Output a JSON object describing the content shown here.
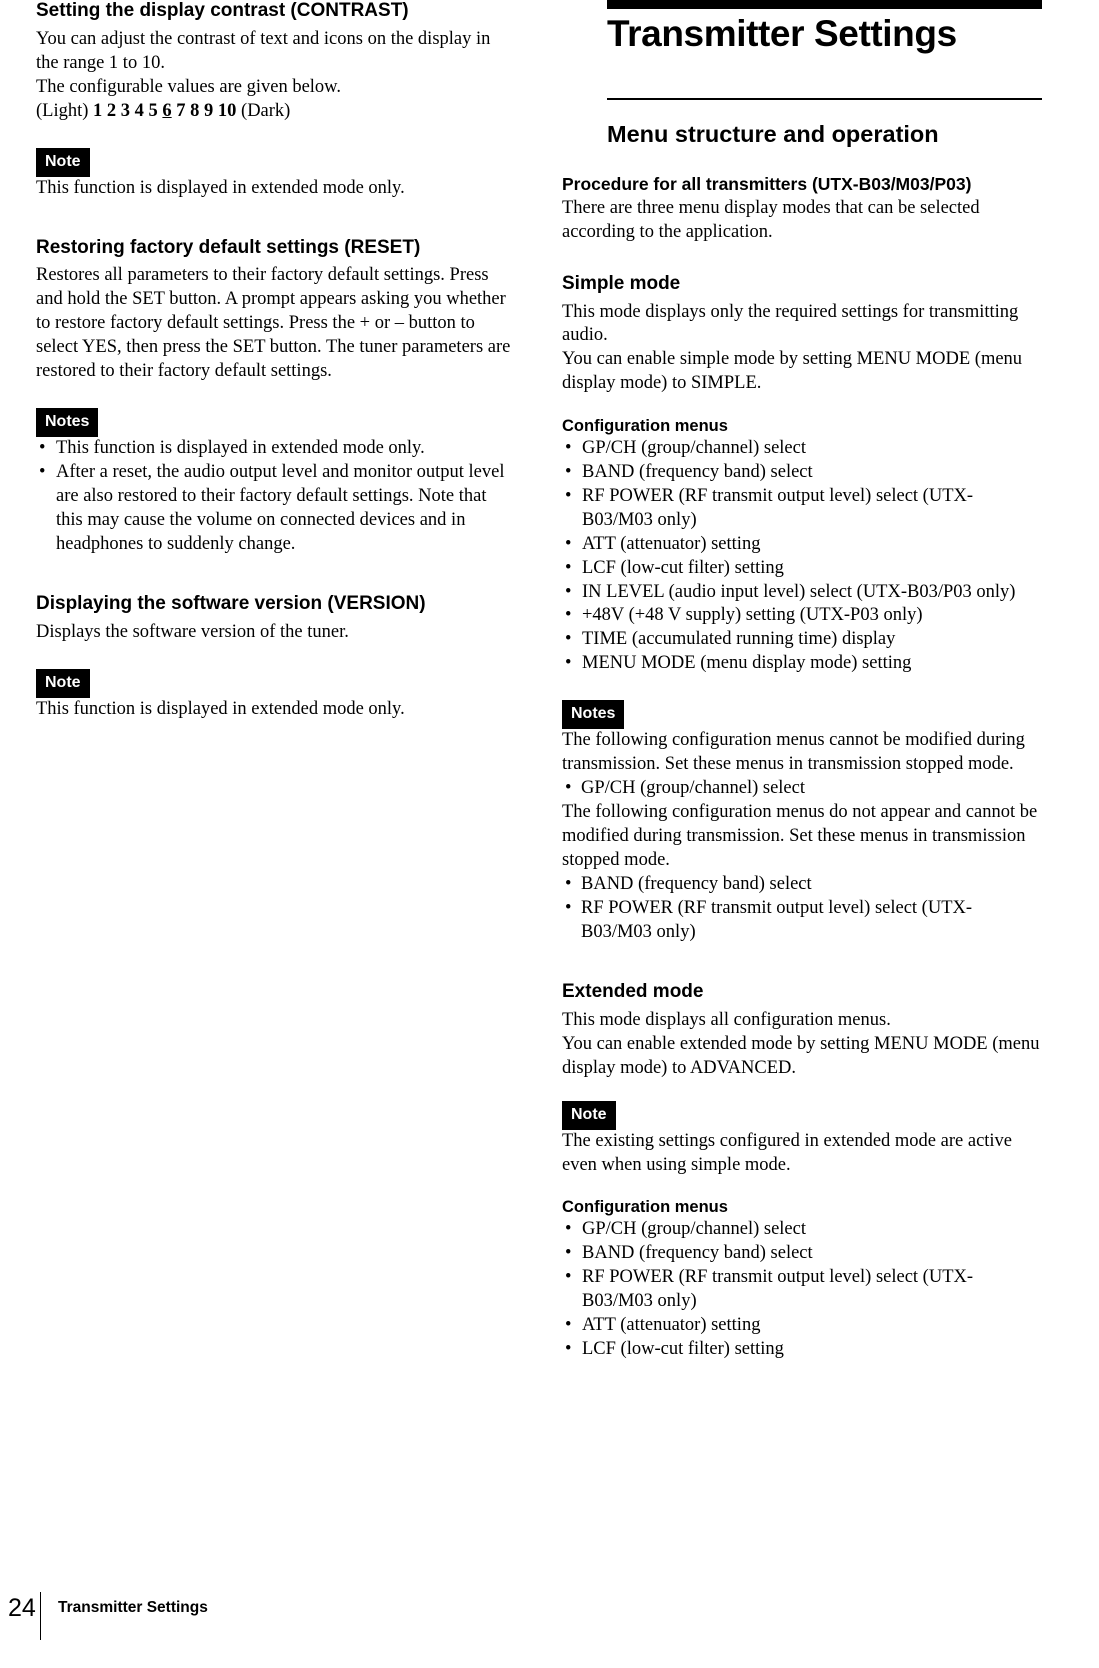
{
  "left_column": {
    "contrast_section": {
      "heading": "Setting the display contrast (CONTRAST)",
      "paragraph": "You can adjust the contrast of text and icons on the display in the range 1 to 10.\nThe configurable values are given below.",
      "scale_prefix": "(Light) ",
      "scale_values_before": "1 2 3 4 5 ",
      "scale_default": "6",
      "scale_values_after": " 7 8 9 10",
      "scale_suffix": " (Dark)",
      "note_label": "Note",
      "note_text": "This function is displayed in extended mode only."
    },
    "reset_section": {
      "heading": "Restoring factory default settings (RESET)",
      "paragraph": "Restores all parameters to their factory default settings. Press and hold the SET button. A prompt appears asking you whether to restore factory default settings. Press the + or – button to select YES, then press the SET button. The tuner parameters are restored to their factory default settings.",
      "notes_label": "Notes",
      "notes": [
        "This function is displayed in extended mode only.",
        "After a reset, the audio output level and monitor output level are also restored to their factory default settings. Note that this may cause the volume on connected devices and in headphones to suddenly change."
      ]
    },
    "version_section": {
      "heading": "Displaying the software version (VERSION)",
      "paragraph": "Displays the software version of the tuner.",
      "note_label": "Note",
      "note_text": "This function is displayed in extended mode only."
    }
  },
  "right_column": {
    "chapter_title": "Transmitter Settings",
    "section_title": "Menu structure and operation",
    "procedure": {
      "heading": "Procedure for all transmitters (UTX-B03/M03/P03)",
      "paragraph": "There are three menu display modes that can be selected according to the application."
    },
    "simple_mode": {
      "heading": "Simple mode",
      "paragraph": "This mode displays only the required settings for transmitting audio.\nYou can enable simple mode by setting MENU MODE (menu display mode) to SIMPLE.",
      "config_heading": "Configuration menus",
      "config_items": [
        "GP/CH (group/channel) select",
        "BAND (frequency band) select",
        "RF POWER (RF transmit output level) select (UTX-B03/M03 only)",
        "ATT (attenuator) setting",
        "LCF (low-cut filter) setting",
        "IN LEVEL (audio input level) select (UTX-B03/P03 only)",
        "+48V (+48 V supply) setting (UTX-P03 only)",
        "TIME (accumulated running time) display",
        "MENU MODE (menu display mode) setting"
      ],
      "notes_label": "Notes",
      "notes_text_1": "The following configuration menus cannot be modified during transmission. Set these menus in transmission stopped mode.",
      "notes_items_1": [
        "GP/CH (group/channel) select"
      ],
      "notes_text_2": "The following configuration menus do not appear and cannot be modified during transmission. Set these menus in transmission stopped mode.",
      "notes_items_2": [
        "BAND (frequency band) select",
        "RF POWER (RF transmit output level) select (UTX-B03/M03 only)"
      ]
    },
    "extended_mode": {
      "heading": "Extended mode",
      "paragraph": "This mode displays all configuration menus.\nYou can enable extended mode by setting MENU MODE (menu display mode) to ADVANCED.",
      "note_label": "Note",
      "note_text": "The existing settings configured in extended mode are active even when using simple mode.",
      "config_heading": "Configuration menus",
      "config_items": [
        "GP/CH (group/channel) select",
        "BAND (frequency band) select",
        "RF POWER (RF transmit output level) select (UTX-B03/M03 only)",
        "ATT (attenuator) setting",
        "LCF (low-cut filter) setting"
      ]
    }
  },
  "footer": {
    "page_number": "24",
    "running_head": "Transmitter Settings"
  }
}
